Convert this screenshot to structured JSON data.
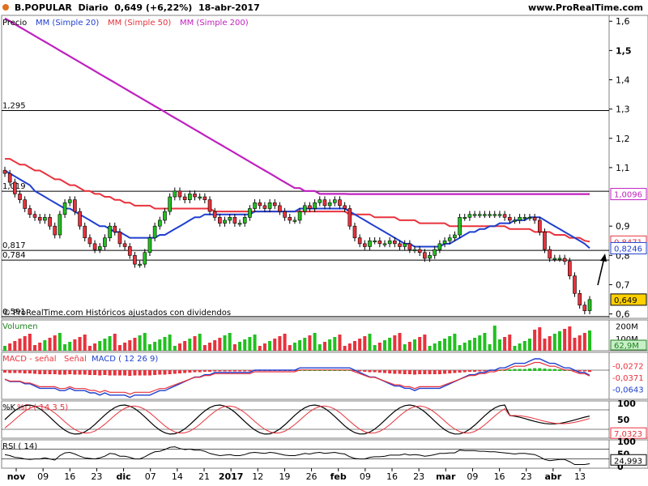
{
  "header": {
    "ticker": "B.POPULAR",
    "period": "Diario",
    "quote": "0,649 (+6,22%)",
    "date": "18-abr-2017",
    "site": "www.ProRealTime.com",
    "status_dot_color": "#e07020"
  },
  "price_panel": {
    "legend": [
      {
        "text": "Precio",
        "color": "#000000"
      },
      {
        "text": "MM (Simple 20)",
        "color": "#1f3fcf"
      },
      {
        "text": "MM (Simple 50)",
        "color": "#e8323c"
      },
      {
        "text": "MM (Simple 200)",
        "color": "#c020c0"
      }
    ],
    "copyright": "© ProRealTime.com  Históricos ajustados con dividendos",
    "hlines": [
      {
        "value": 1.295,
        "label": "1,295"
      },
      {
        "value": 1.019,
        "label": "1,019"
      },
      {
        "value": 0.817,
        "label": "0,817"
      },
      {
        "value": 0.784,
        "label": "0,784"
      },
      {
        "value": 0.591,
        "label": "0,591"
      }
    ],
    "ylim": [
      0.585,
      1.62
    ],
    "ticks": [
      {
        "value": 1.6,
        "label": "1,6",
        "bold": false
      },
      {
        "value": 1.5,
        "label": "1,5",
        "bold": true
      },
      {
        "value": 1.4,
        "label": "1,4",
        "bold": false
      },
      {
        "value": 1.3,
        "label": "1,3",
        "bold": false
      },
      {
        "value": 1.2,
        "label": "1,2",
        "bold": false
      },
      {
        "value": 1.1,
        "label": "1,1",
        "bold": false
      },
      {
        "value": 0.9,
        "label": "0,9",
        "bold": false
      },
      {
        "value": 0.8,
        "label": "0,8",
        "bold": false
      },
      {
        "value": 0.7,
        "label": "0,7",
        "bold": false
      },
      {
        "value": 0.6,
        "label": "0,6",
        "bold": false
      }
    ],
    "value_tags": [
      {
        "value": 1.0096,
        "label": "1,0096",
        "color": "#c020c0",
        "fill": "#ffffff"
      },
      {
        "value": 0.8471,
        "label": "0,8471",
        "color": "#e8323c",
        "fill": "#ffffff"
      },
      {
        "value": 0.8246,
        "label": "0,8246",
        "color": "#1f3fcf",
        "fill": "#ffffff"
      },
      {
        "value": 0.649,
        "label": "0,649",
        "color": "#000000",
        "fill": "#ffd000"
      }
    ]
  },
  "volume_panel": {
    "legend": "Volumen",
    "ticks": [
      {
        "label": "200M",
        "frac": 0.2
      },
      {
        "label": "100M",
        "frac": 0.6
      }
    ],
    "last_value": "62,9M"
  },
  "macd_panel": {
    "legend": [
      {
        "text": "MACD - señal",
        "color": "#e8323c"
      },
      {
        "text": "Señal",
        "color": "#e8323c"
      },
      {
        "text": "MACD ( 12 26 9)",
        "color": "#1f3fcf"
      }
    ],
    "values": [
      {
        "label": "-0,0272",
        "color": "#e8323c",
        "frac": 0.35
      },
      {
        "label": "-0,0371",
        "color": "#e8323c",
        "frac": 0.6
      },
      {
        "label": "-0,0643",
        "color": "#1f3fcf",
        "frac": 0.85
      }
    ]
  },
  "stoch_panel": {
    "legend": [
      {
        "text": "%K",
        "color": "#000000"
      },
      {
        "text": "%D ( 14 3 5)",
        "color": "#e8323c"
      }
    ],
    "ticks": [
      {
        "label": "100",
        "value": 100
      },
      {
        "label": "50",
        "value": 50
      },
      {
        "label": "0",
        "value": 0
      }
    ],
    "values": [
      {
        "label": "7,0323",
        "color": "#e8323c",
        "value": 7.0323
      }
    ]
  },
  "rsi_panel": {
    "legend": "RSI ( 14)",
    "ticks": [
      {
        "label": "100",
        "value": 100
      },
      {
        "label": "50",
        "value": 50
      },
      {
        "label": "0",
        "value": 0
      }
    ],
    "value": {
      "label": "24,993",
      "value": 24.993
    }
  },
  "x_axis": [
    {
      "label": "nov",
      "bold": true
    },
    {
      "label": "09",
      "bold": false
    },
    {
      "label": "16",
      "bold": false
    },
    {
      "label": "23",
      "bold": false
    },
    {
      "label": "dic",
      "bold": true
    },
    {
      "label": "07",
      "bold": false
    },
    {
      "label": "14",
      "bold": false
    },
    {
      "label": "21",
      "bold": false
    },
    {
      "label": "2017",
      "bold": true
    },
    {
      "label": "12",
      "bold": false
    },
    {
      "label": "19",
      "bold": false
    },
    {
      "label": "26",
      "bold": false
    },
    {
      "label": "feb",
      "bold": true
    },
    {
      "label": "09",
      "bold": false
    },
    {
      "label": "16",
      "bold": false
    },
    {
      "label": "23",
      "bold": false
    },
    {
      "label": "mar",
      "bold": true
    },
    {
      "label": "09",
      "bold": false
    },
    {
      "label": "16",
      "bold": false
    },
    {
      "label": "23",
      "bold": false
    },
    {
      "label": "abr",
      "bold": true
    },
    {
      "label": "13",
      "bold": false
    }
  ],
  "chart_data": {
    "type": "candlestick",
    "title": "B.POPULAR Diario",
    "close": [
      1.08,
      1.05,
      1.01,
      0.99,
      0.96,
      0.94,
      0.93,
      0.92,
      0.93,
      0.9,
      0.87,
      0.94,
      0.98,
      0.99,
      0.95,
      0.9,
      0.86,
      0.84,
      0.82,
      0.83,
      0.86,
      0.9,
      0.88,
      0.84,
      0.83,
      0.8,
      0.77,
      0.77,
      0.81,
      0.86,
      0.9,
      0.92,
      0.95,
      1.0,
      1.02,
      1.0,
      0.99,
      1.01,
      1.0,
      1.0,
      0.99,
      0.95,
      0.93,
      0.91,
      0.92,
      0.93,
      0.91,
      0.91,
      0.93,
      0.96,
      0.98,
      0.97,
      0.96,
      0.98,
      0.97,
      0.95,
      0.93,
      0.92,
      0.92,
      0.95,
      0.97,
      0.96,
      0.98,
      0.99,
      0.97,
      0.98,
      0.99,
      0.97,
      0.96,
      0.9,
      0.86,
      0.84,
      0.83,
      0.85,
      0.85,
      0.84,
      0.84,
      0.85,
      0.84,
      0.83,
      0.84,
      0.82,
      0.82,
      0.81,
      0.79,
      0.8,
      0.82,
      0.84,
      0.85,
      0.86,
      0.87,
      0.93,
      0.93,
      0.94,
      0.94,
      0.94,
      0.94,
      0.94,
      0.94,
      0.94,
      0.93,
      0.92,
      0.92,
      0.93,
      0.93,
      0.93,
      0.92,
      0.88,
      0.82,
      0.79,
      0.79,
      0.79,
      0.78,
      0.73,
      0.67,
      0.63,
      0.611,
      0.649
    ],
    "sma20": [
      1.09,
      1.08,
      1.07,
      1.06,
      1.05,
      1.04,
      1.02,
      1.01,
      1.0,
      0.99,
      0.98,
      0.97,
      0.96,
      0.96,
      0.95,
      0.94,
      0.93,
      0.92,
      0.91,
      0.9,
      0.9,
      0.89,
      0.88,
      0.88,
      0.87,
      0.86,
      0.86,
      0.86,
      0.86,
      0.86,
      0.86,
      0.87,
      0.87,
      0.88,
      0.89,
      0.9,
      0.91,
      0.92,
      0.93,
      0.93,
      0.94,
      0.94,
      0.94,
      0.94,
      0.94,
      0.94,
      0.94,
      0.94,
      0.94,
      0.94,
      0.95,
      0.95,
      0.95,
      0.95,
      0.95,
      0.95,
      0.95,
      0.95,
      0.95,
      0.96,
      0.96,
      0.96,
      0.96,
      0.96,
      0.96,
      0.96,
      0.96,
      0.96,
      0.96,
      0.95,
      0.94,
      0.93,
      0.92,
      0.91,
      0.9,
      0.89,
      0.88,
      0.87,
      0.86,
      0.85,
      0.84,
      0.84,
      0.83,
      0.83,
      0.83,
      0.83,
      0.83,
      0.83,
      0.84,
      0.84,
      0.85,
      0.86,
      0.87,
      0.88,
      0.88,
      0.89,
      0.89,
      0.9,
      0.9,
      0.91,
      0.91,
      0.91,
      0.92,
      0.92,
      0.92,
      0.93,
      0.93,
      0.93,
      0.92,
      0.91,
      0.9,
      0.89,
      0.88,
      0.87,
      0.86,
      0.85,
      0.84,
      0.8246
    ],
    "sma50": [
      1.13,
      1.13,
      1.12,
      1.11,
      1.11,
      1.1,
      1.09,
      1.09,
      1.08,
      1.07,
      1.06,
      1.06,
      1.05,
      1.04,
      1.04,
      1.03,
      1.02,
      1.02,
      1.01,
      1.01,
      1.0,
      1.0,
      0.99,
      0.99,
      0.98,
      0.98,
      0.97,
      0.97,
      0.97,
      0.97,
      0.96,
      0.96,
      0.96,
      0.96,
      0.96,
      0.96,
      0.96,
      0.96,
      0.96,
      0.96,
      0.96,
      0.96,
      0.95,
      0.95,
      0.95,
      0.95,
      0.95,
      0.95,
      0.95,
      0.95,
      0.95,
      0.95,
      0.95,
      0.95,
      0.95,
      0.95,
      0.95,
      0.95,
      0.95,
      0.95,
      0.95,
      0.95,
      0.95,
      0.95,
      0.95,
      0.95,
      0.95,
      0.95,
      0.95,
      0.94,
      0.94,
      0.94,
      0.94,
      0.94,
      0.93,
      0.93,
      0.93,
      0.93,
      0.93,
      0.92,
      0.92,
      0.92,
      0.92,
      0.91,
      0.91,
      0.91,
      0.91,
      0.91,
      0.91,
      0.9,
      0.9,
      0.9,
      0.9,
      0.9,
      0.9,
      0.9,
      0.9,
      0.9,
      0.9,
      0.9,
      0.9,
      0.89,
      0.89,
      0.89,
      0.89,
      0.89,
      0.88,
      0.88,
      0.88,
      0.88,
      0.87,
      0.87,
      0.87,
      0.86,
      0.86,
      0.86,
      0.85,
      0.8471
    ],
    "sma200": [
      1.61,
      1.6,
      1.59,
      1.58,
      1.57,
      1.56,
      1.55,
      1.54,
      1.53,
      1.52,
      1.51,
      1.5,
      1.49,
      1.48,
      1.47,
      1.46,
      1.45,
      1.44,
      1.43,
      1.42,
      1.41,
      1.4,
      1.39,
      1.38,
      1.37,
      1.36,
      1.35,
      1.34,
      1.33,
      1.32,
      1.31,
      1.3,
      1.29,
      1.28,
      1.27,
      1.26,
      1.25,
      1.24,
      1.23,
      1.22,
      1.21,
      1.2,
      1.19,
      1.18,
      1.17,
      1.16,
      1.15,
      1.14,
      1.13,
      1.12,
      1.11,
      1.1,
      1.09,
      1.08,
      1.07,
      1.06,
      1.05,
      1.04,
      1.03,
      1.03,
      1.02,
      1.02,
      1.02,
      1.01,
      1.01,
      1.01,
      1.01,
      1.01,
      1.01,
      1.0096,
      1.0096,
      1.0096,
      1.0096,
      1.0096,
      1.0096,
      1.0096,
      1.0096,
      1.0096,
      1.0096,
      1.0096,
      1.0096,
      1.0096,
      1.0096,
      1.0096,
      1.0096,
      1.0096,
      1.0096,
      1.0096,
      1.0096,
      1.0096,
      1.0096,
      1.0096,
      1.0096,
      1.0096,
      1.0096,
      1.0096,
      1.0096,
      1.0096,
      1.0096,
      1.0096,
      1.0096,
      1.0096,
      1.0096,
      1.0096,
      1.0096,
      1.0096,
      1.0096,
      1.0096,
      1.0096,
      1.0096,
      1.0096,
      1.0096,
      1.0096,
      1.0096,
      1.0096,
      1.0096,
      1.0096,
      1.0096
    ],
    "ylim": [
      0.585,
      1.62
    ]
  }
}
